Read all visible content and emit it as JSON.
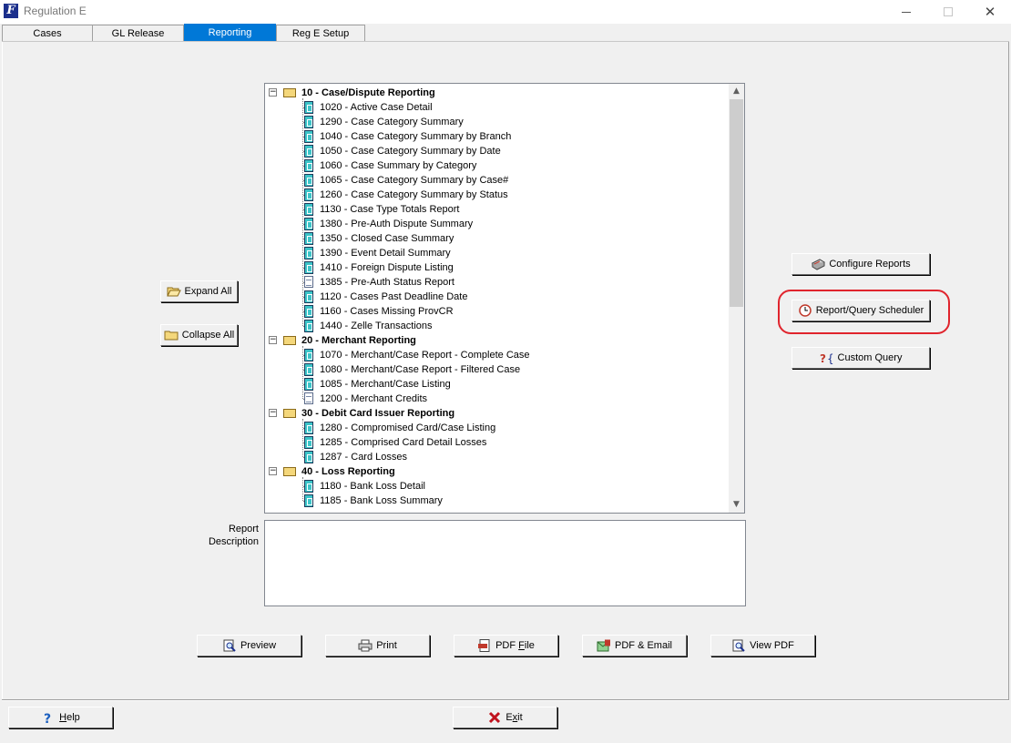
{
  "window": {
    "title": "Regulation E"
  },
  "tabs": [
    {
      "label": "Cases",
      "active": false
    },
    {
      "label": "GL Release",
      "active": false
    },
    {
      "label": "Reporting",
      "active": true
    },
    {
      "label": "Reg E Setup",
      "active": false
    }
  ],
  "left_buttons": {
    "expand_all": "Expand All",
    "collapse_all": "Collapse All"
  },
  "tree": {
    "categories": [
      {
        "label": "10 - Case/Dispute Reporting",
        "items": [
          {
            "label": "1020 - Active Case Detail",
            "icon": "report"
          },
          {
            "label": "1290 - Case Category Summary",
            "icon": "report"
          },
          {
            "label": "1040 - Case Category Summary by Branch",
            "icon": "report"
          },
          {
            "label": "1050 - Case Category Summary by Date",
            "icon": "report"
          },
          {
            "label": "1060 - Case Summary by Category",
            "icon": "report"
          },
          {
            "label": "1065 - Case Category Summary by Case#",
            "icon": "report"
          },
          {
            "label": "1260 - Case Category Summary by Status",
            "icon": "report"
          },
          {
            "label": "1130 - Case Type Totals Report",
            "icon": "report"
          },
          {
            "label": "1380 - Pre-Auth Dispute Summary",
            "icon": "report"
          },
          {
            "label": "1350 - Closed Case Summary",
            "icon": "report"
          },
          {
            "label": "1390 - Event Detail Summary",
            "icon": "report"
          },
          {
            "label": "1410 - Foreign Dispute Listing",
            "icon": "report"
          },
          {
            "label": "1385 - Pre-Auth Status Report",
            "icon": "document"
          },
          {
            "label": "1120 - Cases Past Deadline Date",
            "icon": "report"
          },
          {
            "label": "1160 - Cases Missing ProvCR",
            "icon": "report"
          },
          {
            "label": "1440 - Zelle Transactions",
            "icon": "report"
          }
        ]
      },
      {
        "label": "20 - Merchant Reporting",
        "items": [
          {
            "label": "1070 - Merchant/Case Report - Complete Case",
            "icon": "report"
          },
          {
            "label": "1080 - Merchant/Case Report - Filtered Case",
            "icon": "report"
          },
          {
            "label": "1085 - Merchant/Case Listing",
            "icon": "report"
          },
          {
            "label": "1200 - Merchant Credits",
            "icon": "document"
          }
        ]
      },
      {
        "label": "30 - Debit Card Issuer Reporting",
        "items": [
          {
            "label": "1280 - Compromised Card/Case Listing",
            "icon": "report"
          },
          {
            "label": "1285 - Comprised Card Detail Losses",
            "icon": "report"
          },
          {
            "label": "1287 - Card Losses",
            "icon": "report"
          }
        ]
      },
      {
        "label": "40 - Loss Reporting",
        "items": [
          {
            "label": "1180 - Bank Loss Detail",
            "icon": "report"
          },
          {
            "label": "1185 - Bank Loss Summary",
            "icon": "report"
          }
        ]
      }
    ]
  },
  "description": {
    "label_line1": "Report",
    "label_line2": "Description",
    "value": ""
  },
  "right_buttons": {
    "configure": "Configure Reports",
    "scheduler": "Report/Query Scheduler",
    "custom_query": "Custom Query"
  },
  "output_buttons": {
    "preview": "Preview",
    "print": "Print",
    "pdf_file_prefix": "PDF ",
    "pdf_file_underlined": "F",
    "pdf_file_suffix": "ile",
    "pdf_email": "PDF & Email",
    "view_pdf": "View PDF"
  },
  "footer": {
    "help_underlined": "H",
    "help_rest": "elp",
    "exit_prefix": "E",
    "exit_underlined": "x",
    "exit_suffix": "it"
  },
  "colors": {
    "active_tab": "#0078d7",
    "highlight_ring": "#e0242d"
  }
}
